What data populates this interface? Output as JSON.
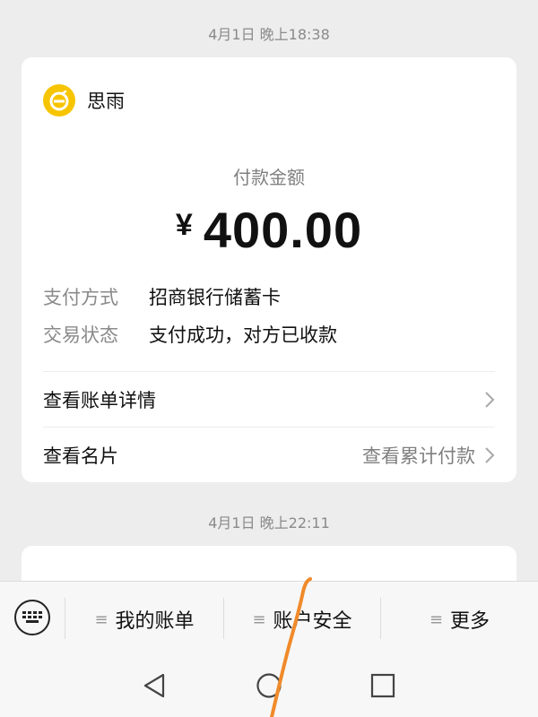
{
  "messages": [
    {
      "timestamp": "4月1日 晚上18:38",
      "merchant_name": "思雨",
      "amount_label": "付款金额",
      "currency": "¥",
      "amount": "400.00",
      "details": [
        {
          "key": "支付方式",
          "value": "招商银行储蓄卡"
        },
        {
          "key": "交易状态",
          "value": "支付成功，对方已收款"
        }
      ],
      "links": [
        {
          "label": "查看账单详情",
          "right_text": ""
        },
        {
          "label": "查看名片",
          "right_text": "查看累计付款"
        }
      ]
    },
    {
      "timestamp": "4月1日 晚上22:11"
    }
  ],
  "menu": {
    "items": [
      {
        "label": "我的账单"
      },
      {
        "label": "账户安全"
      },
      {
        "label": "更多"
      }
    ]
  },
  "icons": {
    "keyboard": "keyboard-icon",
    "chevron": "chevron-right-icon",
    "menu_bars": "hamburger-icon",
    "back": "back-triangle-icon",
    "home": "home-circle-icon",
    "recents": "recents-square-icon"
  },
  "colors": {
    "background": "#ededed",
    "card": "#ffffff",
    "logo": "#f7c400",
    "scribble": "#f08a2a"
  }
}
